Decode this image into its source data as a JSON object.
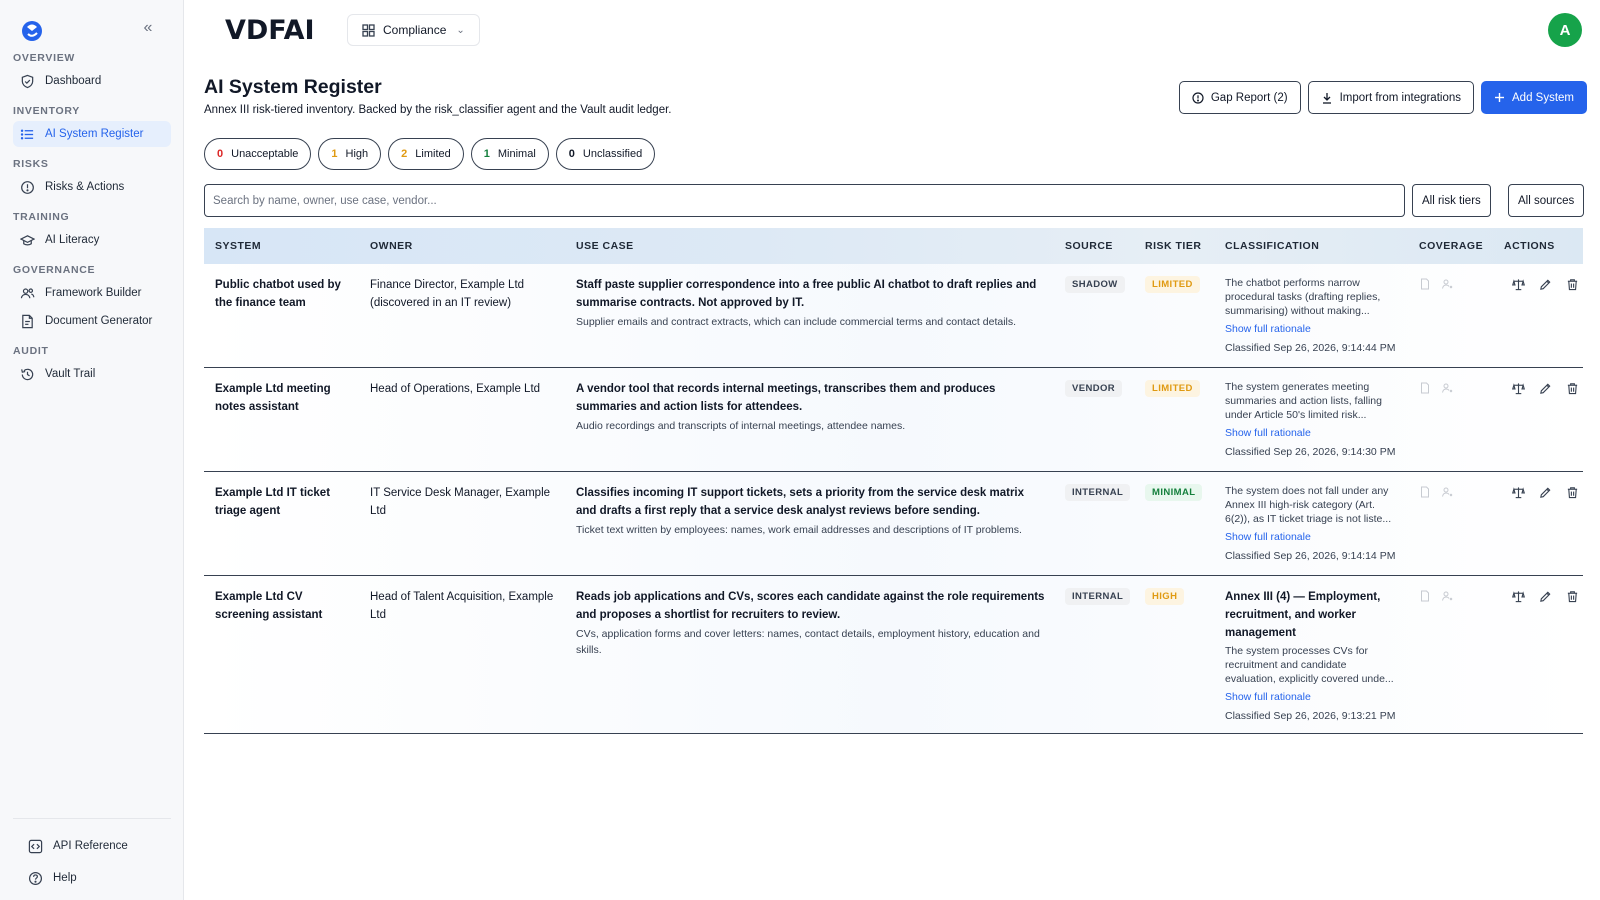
{
  "app": {
    "brand": "VDFAI",
    "workspace": "Compliance",
    "avatar_initial": "A",
    "accent": "#2563eb",
    "avatar_color": "#16a34a"
  },
  "sidebar": {
    "sections": [
      {
        "title": "Overview",
        "items": [
          {
            "label": "Dashboard",
            "icon": "shield-icon",
            "active": false
          }
        ]
      },
      {
        "title": "Inventory",
        "items": [
          {
            "label": "AI System Register",
            "icon": "list-icon",
            "active": true
          }
        ]
      },
      {
        "title": "Risks",
        "items": [
          {
            "label": "Risks & Actions",
            "icon": "alert-circle-icon",
            "active": false
          }
        ]
      },
      {
        "title": "Training",
        "items": [
          {
            "label": "AI Literacy",
            "icon": "graduation-cap-icon",
            "active": false
          }
        ]
      },
      {
        "title": "Governance",
        "items": [
          {
            "label": "Framework Builder",
            "icon": "users-icon",
            "active": false
          },
          {
            "label": "Document Generator",
            "icon": "file-icon",
            "active": false
          }
        ]
      },
      {
        "title": "Audit",
        "items": [
          {
            "label": "Vault Trail",
            "icon": "history-icon",
            "active": false
          }
        ]
      }
    ],
    "bottom": [
      {
        "label": "API Reference",
        "icon": "code-icon"
      },
      {
        "label": "Help",
        "icon": "help-circle-icon"
      }
    ]
  },
  "page": {
    "title": "AI System Register",
    "subtitle": "Annex III risk-tiered inventory. Backed by the risk_classifier agent and the Vault audit ledger.",
    "buttons": {
      "gap_report": "Gap Report (2)",
      "import": "Import from integrations",
      "add": "Add System"
    }
  },
  "tiers": [
    {
      "count": "0",
      "label": "Unacceptable",
      "color": "#dc2626"
    },
    {
      "count": "1",
      "label": "High",
      "color": "#e09a12"
    },
    {
      "count": "2",
      "label": "Limited",
      "color": "#e09a12"
    },
    {
      "count": "1",
      "label": "Minimal",
      "color": "#15803d"
    },
    {
      "count": "0",
      "label": "Unclassified",
      "color": "#111827"
    }
  ],
  "search": {
    "placeholder": "Search by name, owner, use case, vendor...",
    "filter_tiers": "All risk tiers",
    "filter_sources": "All sources"
  },
  "table": {
    "columns": [
      "System",
      "Owner",
      "Use Case",
      "Source",
      "Risk Tier",
      "Classification",
      "Coverage",
      "Actions"
    ],
    "rows": [
      {
        "system": "Public chatbot used by the finance team",
        "owner": "Finance Director, Example Ltd (discovered in an IT review)",
        "use_case": "Staff paste supplier correspondence into a free public AI chatbot to draft replies and summarise contracts. Not approved by IT.",
        "data": "Supplier emails and contract extracts, which can include commercial terms and contact details.",
        "source": "Shadow",
        "tier": "Limited",
        "tier_class": "limited",
        "classification_head": "",
        "classification": "The chatbot performs narrow procedural tasks (drafting replies, summarising) without making...",
        "link": "Show full rationale",
        "classified": "Classified Sep 26, 2026, 9:14:44 PM"
      },
      {
        "system": "Example Ltd meeting notes assistant",
        "owner": "Head of Operations, Example Ltd",
        "use_case": "A vendor tool that records internal meetings, transcribes them and produces summaries and action lists for attendees.",
        "data": "Audio recordings and transcripts of internal meetings, attendee names.",
        "source": "Vendor",
        "tier": "Limited",
        "tier_class": "limited",
        "classification_head": "",
        "classification": "The system generates meeting summaries and action lists, falling under Article 50's limited risk...",
        "link": "Show full rationale",
        "classified": "Classified Sep 26, 2026, 9:14:30 PM"
      },
      {
        "system": "Example Ltd IT ticket triage agent",
        "owner": "IT Service Desk Manager, Example Ltd",
        "use_case": "Classifies incoming IT support tickets, sets a priority from the service desk matrix and drafts a first reply that a service desk analyst reviews before sending.",
        "data": "Ticket text written by employees: names, work email addresses and descriptions of IT problems.",
        "source": "Internal",
        "tier": "Minimal",
        "tier_class": "minimal",
        "classification_head": "",
        "classification": "The system does not fall under any Annex III high-risk category (Art. 6(2)), as IT ticket triage is not liste...",
        "link": "Show full rationale",
        "classified": "Classified Sep 26, 2026, 9:14:14 PM"
      },
      {
        "system": "Example Ltd CV screening assistant",
        "owner": "Head of Talent Acquisition, Example Ltd",
        "use_case": "Reads job applications and CVs, scores each candidate against the role requirements and proposes a shortlist for recruiters to review.",
        "data": "CVs, application forms and cover letters: names, contact details, employment history, education and skills.",
        "source": "Internal",
        "tier": "High",
        "tier_class": "high",
        "classification_head": "Annex III (4) — Employment, recruitment, and worker management",
        "classification": "The system processes CVs for recruitment and candidate evaluation, explicitly covered unde...",
        "link": "Show full rationale",
        "classified": "Classified Sep 26, 2026, 9:13:21 PM"
      }
    ]
  }
}
